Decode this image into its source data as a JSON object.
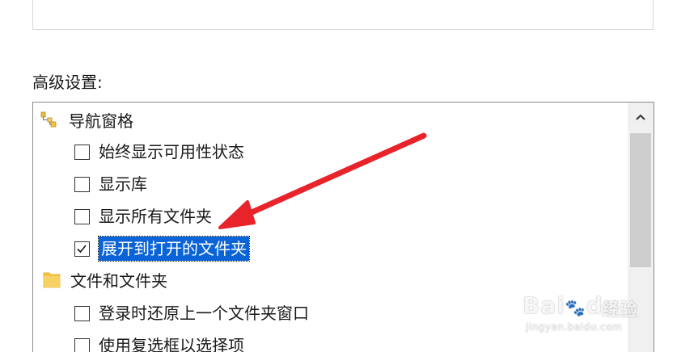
{
  "advanced_settings": {
    "label": "高级设置:"
  },
  "tree": {
    "items": [
      {
        "type": "group",
        "label": "导航窗格",
        "icon": "navigation-pane-icon"
      },
      {
        "type": "checkbox",
        "label": "始终显示可用性状态",
        "checked": false
      },
      {
        "type": "checkbox",
        "label": "显示库",
        "checked": false
      },
      {
        "type": "checkbox",
        "label": "显示所有文件夹",
        "checked": false
      },
      {
        "type": "checkbox",
        "label": "展开到打开的文件夹",
        "checked": true,
        "selected": true
      },
      {
        "type": "group",
        "label": "文件和文件夹",
        "icon": "folder-icon"
      },
      {
        "type": "checkbox",
        "label": "登录时还原上一个文件夹窗口",
        "checked": false
      },
      {
        "type": "checkbox",
        "label": "使用复选框以选择项",
        "checked": false
      }
    ]
  },
  "colors": {
    "selection": "#0a64d8",
    "annotation_arrow": "#e8232a",
    "folder": "#f5c342"
  },
  "watermark": {
    "brand": "Bai",
    "brand_du": "du",
    "jingyan": "经验",
    "url": "jingyan.baidu.com"
  }
}
